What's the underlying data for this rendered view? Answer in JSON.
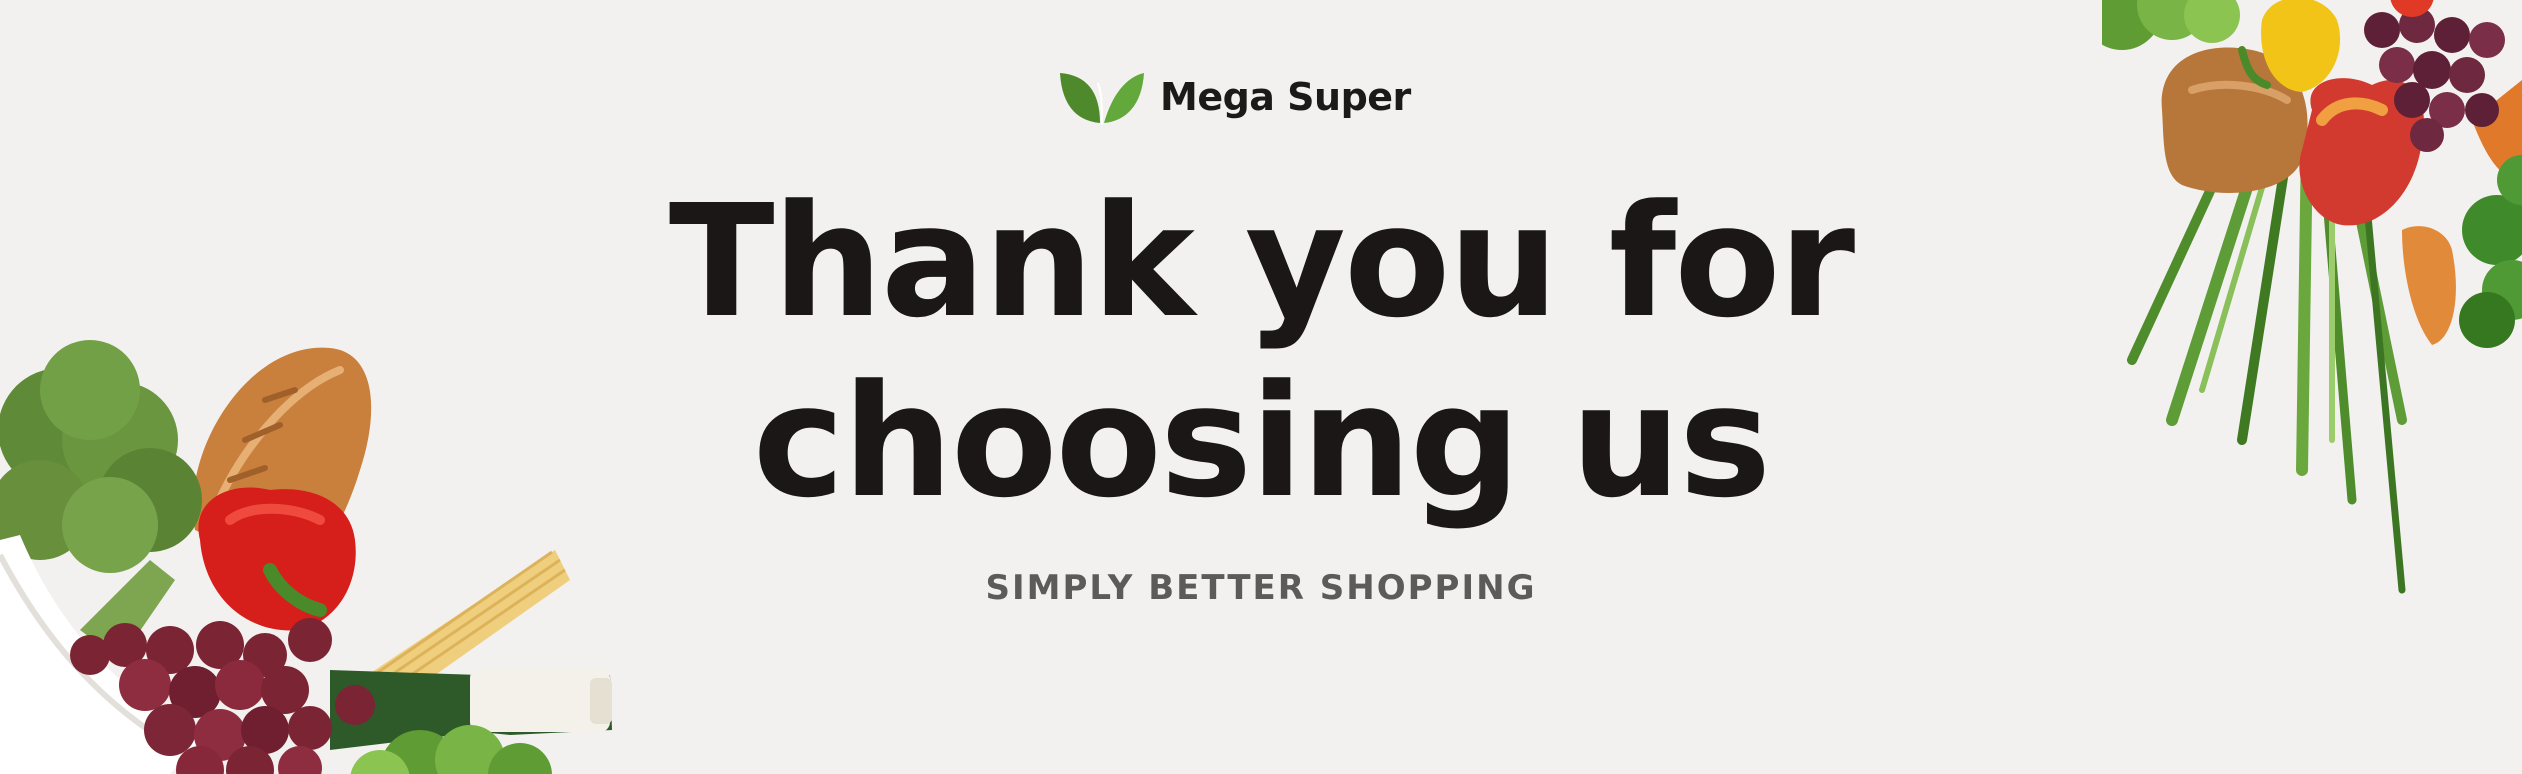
{
  "brand": {
    "name": "Mega Super",
    "logo_icon": "leaf-icon",
    "accent_color": "#4e8a2c"
  },
  "hero": {
    "headline_line1": "Thank you for",
    "headline_line2": "choosing us",
    "tagline": "SIMPLY BETTER SHOPPING"
  },
  "palette": {
    "background": "#f3f1ef",
    "headline": "#1a1716",
    "tagline": "#5d5b5a"
  },
  "decorations": {
    "left_icon": "grocery-bag-illustration",
    "right_icon": "vegetables-illustration"
  }
}
